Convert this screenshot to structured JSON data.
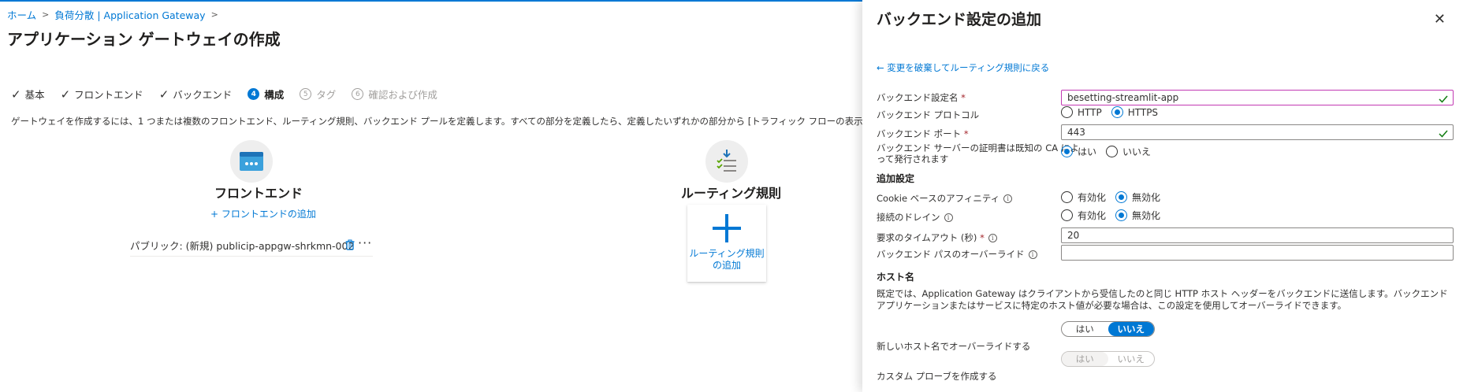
{
  "breadcrumb": [
    "ホーム",
    "負荷分散 | Application Gateway"
  ],
  "page": {
    "title": "アプリケーション ゲートウェイの作成",
    "more": "..."
  },
  "steps": [
    {
      "label": "基本",
      "status": "done"
    },
    {
      "label": "フロントエンド",
      "status": "done"
    },
    {
      "label": "バックエンド",
      "status": "done"
    },
    {
      "num": "4",
      "label": "構成",
      "status": "active"
    },
    {
      "num": "5",
      "label": "タグ",
      "status": "disabled"
    },
    {
      "num": "6",
      "label": "確認および作成",
      "status": "disabled"
    }
  ],
  "description": "ゲートウェイを作成するには、1 つまたは複数のフロントエンド、ルーティング規則、バックエンド プールを定義します。すべての部分を定義したら、定義したいずれかの部分から [トラフィック フローの表示] を選択して、トラフィックがゲートウェイを通",
  "frontend": {
    "title": "フロントエンド",
    "add_link": "+ フロントエンドの追加",
    "item": "パブリック: (新規) publicip-appgw-shrkmn-002"
  },
  "routing": {
    "title": "ルーティング規則",
    "add_line1": "ルーティング規則",
    "add_line2": "の追加"
  },
  "panel": {
    "title": "バックエンド設定の追加",
    "back_link": "← 変更を破棄してルーティング規則に戻る",
    "fields": {
      "name_label": "バックエンド設定名",
      "name_value": "besetting-streamlit-app",
      "protocol_label": "バックエンド プロトコル",
      "protocol_options": [
        "HTTP",
        "HTTPS"
      ],
      "protocol_selected": "HTTPS",
      "port_label": "バックエンド ポート",
      "port_value": "443",
      "cert_label_line1": "バックエンド サーバーの証明書は既知の CA によ",
      "cert_label_line2": "って発行されます",
      "cert_options": [
        "はい",
        "いいえ"
      ],
      "cert_selected": "はい"
    },
    "additional": {
      "heading": "追加設定",
      "affinity_label": "Cookie ベースのアフィニティ",
      "affinity_options": [
        "有効化",
        "無効化"
      ],
      "affinity_selected": "無効化",
      "drain_label": "接続のドレイン",
      "drain_options": [
        "有効化",
        "無効化"
      ],
      "drain_selected": "無効化",
      "timeout_label": "要求のタイムアウト (秒)",
      "timeout_value": "20",
      "path_label": "バックエンド パスのオーバーライド",
      "path_value": ""
    },
    "host": {
      "heading": "ホスト名",
      "hint": "既定では、Application Gateway はクライアントから受信したのと同じ HTTP ホスト ヘッダーをバックエンドに送信します。バックエンド アプリケーションまたはサービスに特定のホスト値が必要な場合は、この設定を使用してオーバーライドできます。",
      "override_label": "新しいホスト名でオーバーライドする",
      "override_options": [
        "はい",
        "いいえ"
      ],
      "override_selected": "いいえ",
      "probe_label": "カスタム プローブを作成する",
      "probe_options": [
        "はい",
        "いいえ"
      ],
      "probe_selected": "はい"
    }
  },
  "colors": {
    "accent": "#0078d4",
    "success": "#107c10",
    "required": "#a4262c",
    "focus": "#c239b3"
  }
}
